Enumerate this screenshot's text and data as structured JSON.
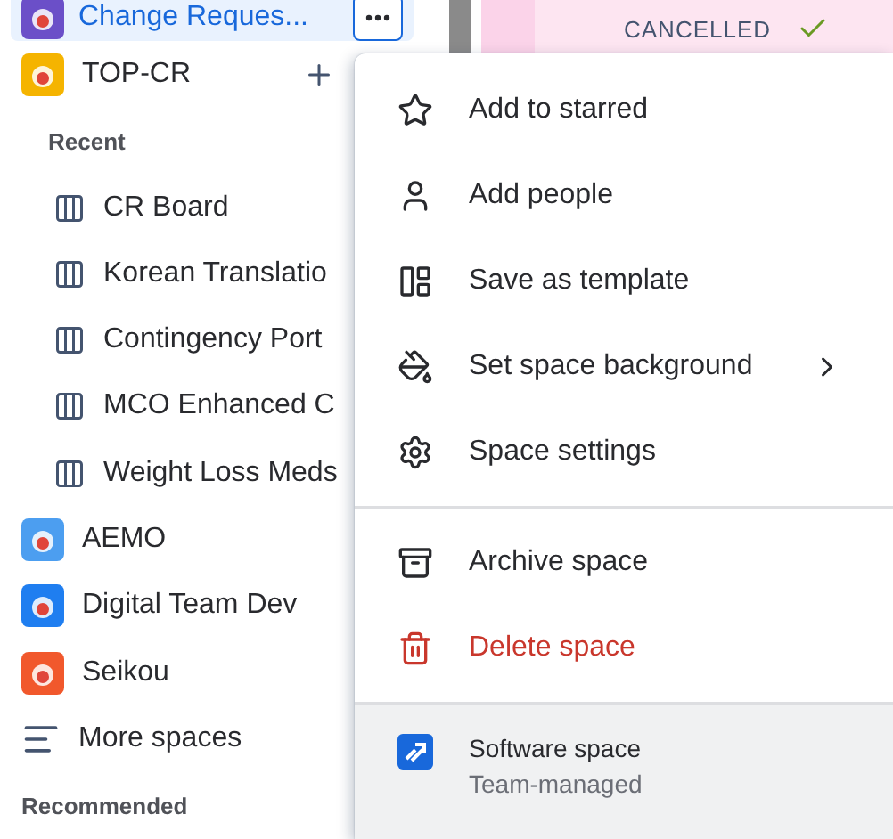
{
  "sidebar": {
    "current": {
      "name": "Change Reques...",
      "selected": true,
      "color": "#6b4fc8"
    },
    "items": [
      {
        "kind": "space",
        "name": "TOP-CR",
        "color": "#f5b400",
        "add": true
      },
      {
        "kind": "heading",
        "name": "Recent"
      },
      {
        "kind": "board",
        "name": "CR Board"
      },
      {
        "kind": "board",
        "name": "Korean Translatio"
      },
      {
        "kind": "board",
        "name": "Contingency Port"
      },
      {
        "kind": "board",
        "name": "MCO Enhanced C"
      },
      {
        "kind": "board",
        "name": "Weight Loss Meds"
      },
      {
        "kind": "space",
        "name": "AEMO",
        "color": "#4c9ef0"
      },
      {
        "kind": "space",
        "name": "Digital Team Dev",
        "color": "#1f7ef0"
      },
      {
        "kind": "space",
        "name": "Seikou",
        "color": "#f1582c"
      },
      {
        "kind": "more",
        "name": "More spaces"
      },
      {
        "kind": "section",
        "name": "Recommended"
      }
    ]
  },
  "content": {
    "status": "CANCELLED",
    "done": true
  },
  "menu": {
    "groups": [
      [
        {
          "label": "Add to starred"
        },
        {
          "label": "Add people"
        },
        {
          "label": "Save as template"
        },
        {
          "label": "Set space background",
          "submenu": true
        },
        {
          "label": "Space settings"
        }
      ],
      [
        {
          "label": "Archive space",
          "danger": false
        },
        {
          "label": "Delete space",
          "danger": true
        }
      ]
    ],
    "footer": {
      "title": "Software space",
      "subtitle": "Team-managed"
    }
  }
}
